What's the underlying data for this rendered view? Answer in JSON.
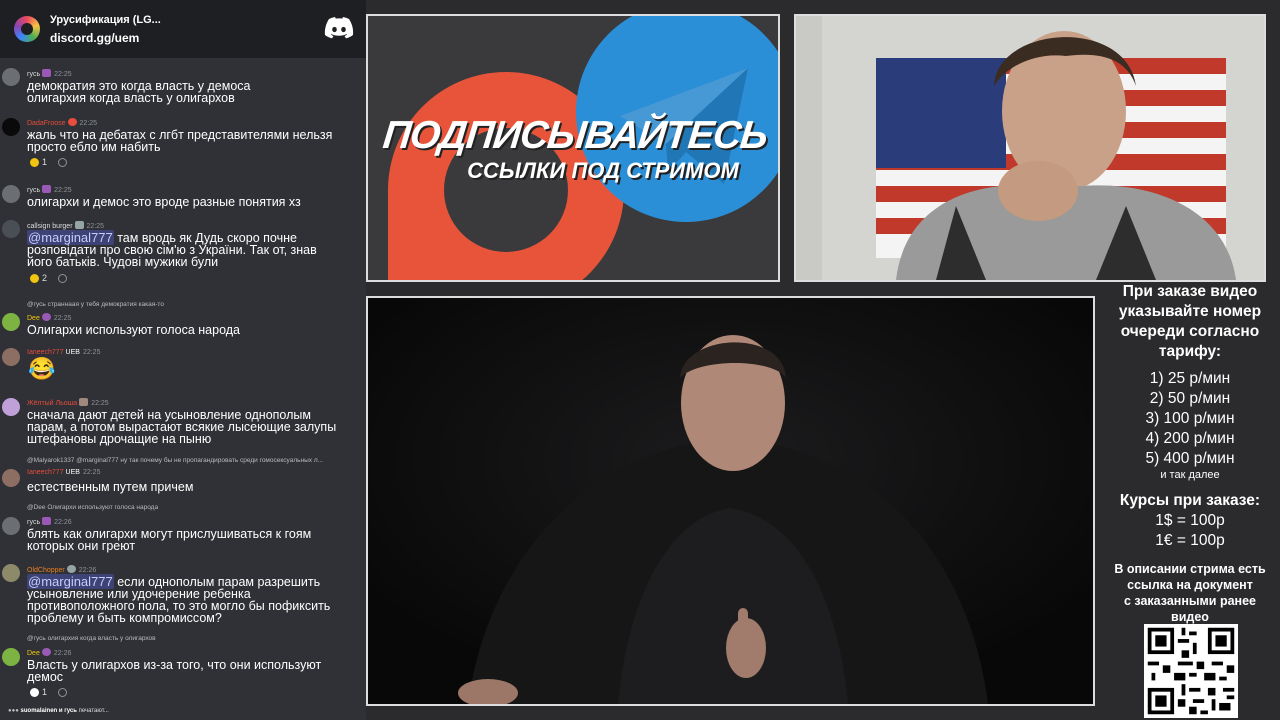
{
  "chat": {
    "server_name": "Урусификация (LG...",
    "server_invite": "discord.gg/uem",
    "typing": {
      "users": "suomalainen и гусь",
      "suffix": "печатают..."
    },
    "messages": [
      {
        "author": "гусь",
        "author_color": "#dcddde",
        "time": "22:25",
        "lines": [
          "демократия это когда власть у демоса",
          "олигархия когда власть у олигархов"
        ]
      },
      {
        "author": "DadaFroose",
        "author_color": "#e74c3c",
        "time": "22:25",
        "lines": [
          "жаль что на дебатах с лгбт представителями нельзя",
          "просто ебло им набить"
        ],
        "reaction_count": "1"
      },
      {
        "author": "гусь",
        "author_color": "#dcddde",
        "time": "22:25",
        "lines": [
          "олигархи и демос это вроде разные понятия хз"
        ]
      },
      {
        "author": "callsign burger",
        "author_color": "#dcddde",
        "time": "22:25",
        "mention": "@marginal777",
        "lines": [
          " там вродь як Дудь скоро почне",
          "розповідати про свою сім'ю з України. Так от, знав",
          "його батьків. Чудові мужики були"
        ],
        "reaction_count": "2"
      },
      {
        "reply": "@гусь страннаая у тебя демократия какая-то",
        "author": "Dee",
        "author_color": "#f1c40f",
        "time": "22:25",
        "lines": [
          "Олигархи используют голоса народа"
        ]
      },
      {
        "author": "Ianeech777",
        "author_color": "#e74c3c",
        "badge": "UEB",
        "time": "22:25",
        "emoji": "😂"
      },
      {
        "author": "Жёлтый Льоша",
        "author_color": "#e74c3c",
        "time": "22:25",
        "lines": [
          "сначала дают детей на усыновление однополым",
          "парам, а потом вырастают всякие лысеющие залупы",
          "штефановы дрочащие на пыню"
        ]
      },
      {
        "reply": "@Malyarok1337 @marginal777 ну так почему бы не пропагандировать среди гомосексуальных л...",
        "author": "Ianeech777",
        "author_color": "#e74c3c",
        "badge": "UEB",
        "time": "22:25",
        "lines": [
          "естественным путем причем"
        ]
      },
      {
        "reply": "@Dee Олигархи используют голоса народа",
        "author": "гусь",
        "author_color": "#dcddde",
        "time": "22:26",
        "lines": [
          "блять как олигархи могут прислушиваться к гоям",
          "которых они греют"
        ]
      },
      {
        "author": "OldChopper",
        "author_color": "#e67e22",
        "time": "22:26",
        "mention": "@marginal777",
        "lines": [
          " если однополым парам разрешить",
          "усыновление или удочерение ребенка",
          "противоположного пола, то это могло бы пофиксить",
          "проблему и быть компромиссом?"
        ]
      },
      {
        "reply": "@гусь олигархия когда власть у олигархов",
        "author": "Dee",
        "author_color": "#f1c40f",
        "time": "22:26",
        "lines": [
          "Власть у олигархов из-за того, что они используют",
          "демос"
        ],
        "reaction_count": "1"
      }
    ]
  },
  "promo": {
    "headline": "ПОДПИСЫВАЙТЕСЬ",
    "subline": "ССЫЛКИ ПОД СТРИМОМ"
  },
  "info": {
    "title_lines": [
      "При заказе видео",
      "указывайте номер",
      "очереди согласно",
      "тарифу:"
    ],
    "tariffs": [
      "1) 25 р/мин",
      "2) 50 р/мин",
      "3) 100 р/мин",
      "4) 200 р/мин",
      "5) 400 р/мин"
    ],
    "tariff_note": "и так далее",
    "rates_title": "Курсы при заказе:",
    "rates": [
      "1$ = 100р",
      "1€ = 100р"
    ],
    "description_lines": [
      "В описании стрима есть",
      "ссылка на документ",
      "с заказанными ранее",
      "видео"
    ]
  },
  "colors": {
    "chat_bg": "#2f3136",
    "header_bg": "#1e1f22",
    "mention_bg": "#5865f2",
    "page_bg": "#2b2b2d",
    "patreon_orange": "#e8543a",
    "telegram_blue": "#2b8fd8"
  }
}
